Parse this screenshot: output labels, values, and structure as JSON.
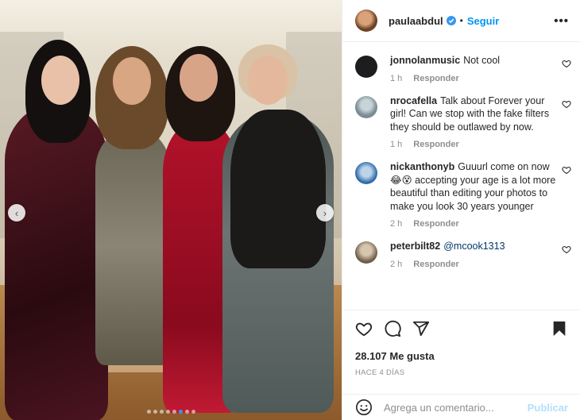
{
  "post": {
    "author": "paulaabdul",
    "follow_label": "Seguir",
    "separator": "•",
    "more_label": "•••"
  },
  "photo": {
    "prev_label": "‹",
    "next_label": "›",
    "slides_count": 8,
    "active_slide": 6
  },
  "comments": [
    {
      "user": "jonnolanmusic",
      "text": "Not cool",
      "time": "1 h",
      "reply": "Responder",
      "avatar_color": "#1d1d1f"
    },
    {
      "user": "nrocafella",
      "text": "Talk about Forever your girl! Can we stop with the fake filters they should be outlawed by now.",
      "time": "1 h",
      "reply": "Responder",
      "avatar_color": "#8aa0a8"
    },
    {
      "user": "nickanthonyb",
      "text": "Guuurl come on now 😂😵 accepting your age is a lot more beautiful than editing your photos to make you look 30 years younger",
      "time": "2 h",
      "reply": "Responder",
      "avatar_color": "#3f7ab8"
    },
    {
      "user": "peterbilt82",
      "text": "@mcook1313",
      "time": "2 h",
      "reply": "Responder",
      "avatar_color": "#7a6a55"
    }
  ],
  "actions": {
    "likes": "28.107 Me gusta",
    "date": "HACE 4 DÍAS"
  },
  "add_comment": {
    "placeholder": "Agrega un comentario...",
    "publish_label": "Publicar"
  },
  "colors": {
    "accent": "#0095f6",
    "publish_disabled": "#b2dffc",
    "active_dot": "#3897f0"
  }
}
